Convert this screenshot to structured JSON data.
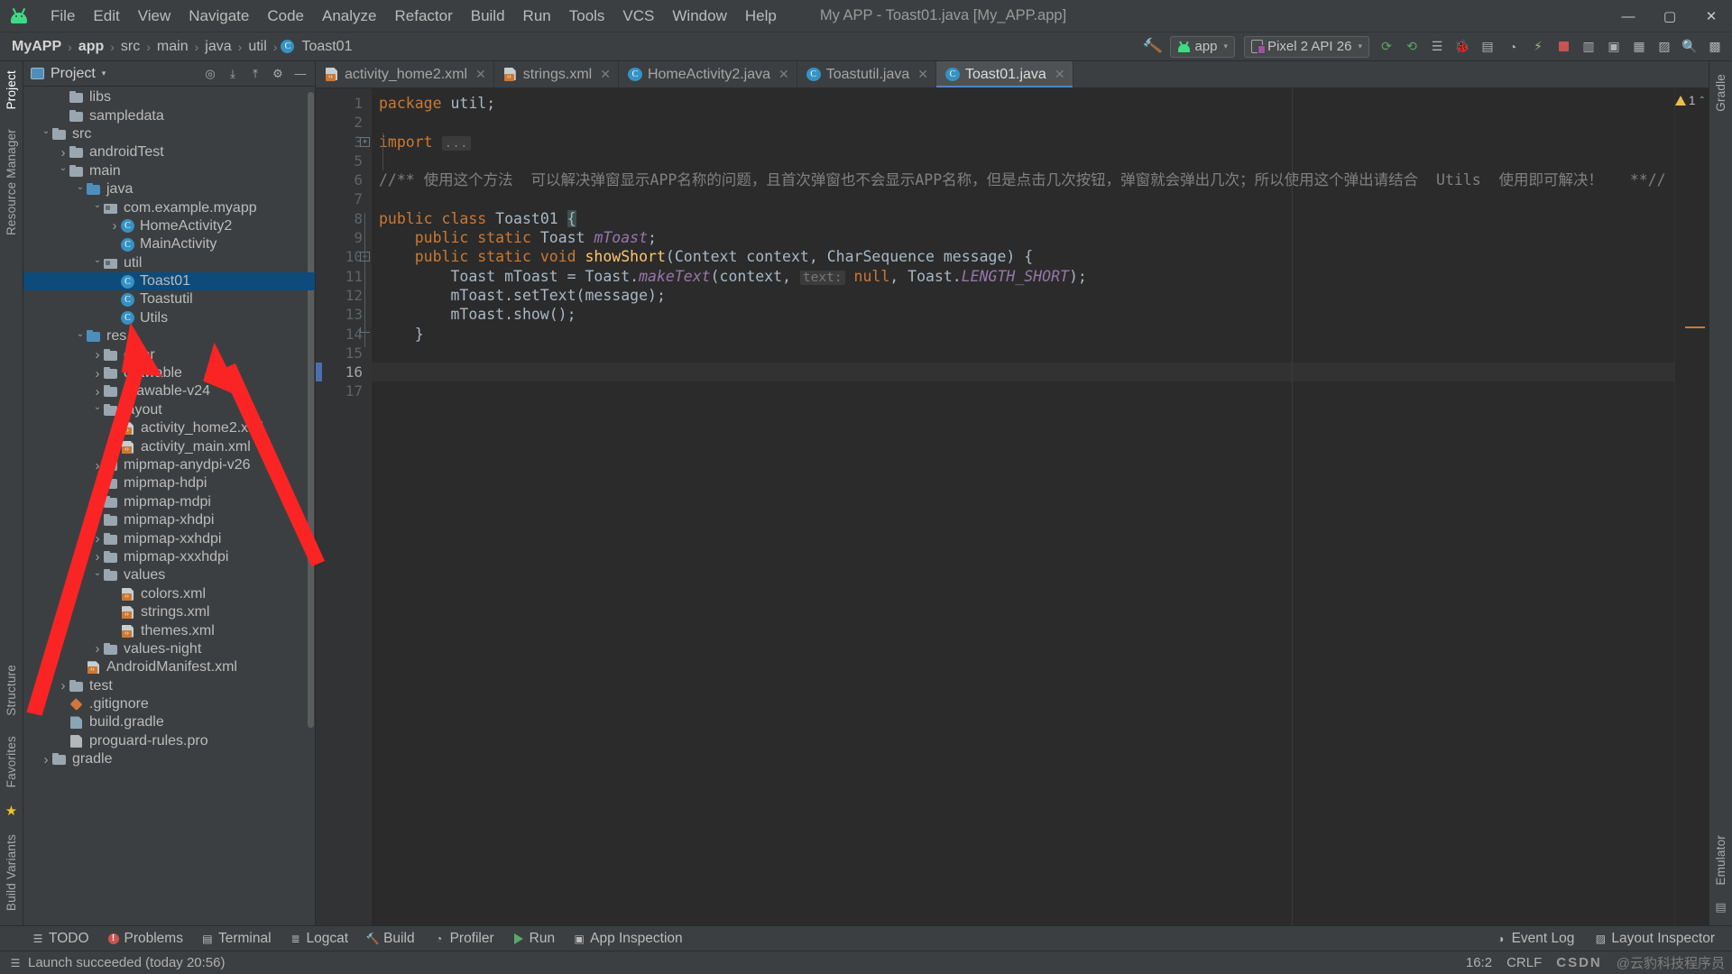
{
  "window": {
    "title": "My APP - Toast01.java [My_APP.app]",
    "minimize": "—",
    "maximize": "▢",
    "close": "✕"
  },
  "menubar": {
    "logo": "android-logo",
    "items": [
      "File",
      "Edit",
      "View",
      "Navigate",
      "Code",
      "Analyze",
      "Refactor",
      "Build",
      "Run",
      "Tools",
      "VCS",
      "Window",
      "Help"
    ]
  },
  "breadcrumb": {
    "items": [
      "MyAPP",
      "app",
      "src",
      "main",
      "java",
      "util",
      "Toast01"
    ],
    "separator": "›",
    "class_badge": "C"
  },
  "toolbar": {
    "build_label": "build-hammer-icon",
    "run_config": "app",
    "device": "Pixel 2 API 26",
    "caret": "▾",
    "icons": [
      "sync-gradle-icon",
      "rerun-icon",
      "avd-manager-icon",
      "debug-icon",
      "attach-debugger-icon",
      "profiler-icon",
      "stop-icon",
      "layout-inspector-icon",
      "sdk-manager-icon",
      "device-file-explorer-icon",
      "search-everywhere-icon",
      "project-structure-icon"
    ]
  },
  "project_panel": {
    "title": "Project",
    "caret": "▾",
    "tools": [
      "locate-icon",
      "expand-all-icon",
      "collapse-all-icon",
      "settings-icon",
      "hide-icon"
    ],
    "tree": [
      {
        "depth": 3,
        "arrow": "none",
        "icon": "folder",
        "label": "libs"
      },
      {
        "depth": 3,
        "arrow": "none",
        "icon": "folder",
        "label": "sampledata"
      },
      {
        "depth": 2,
        "arrow": "down",
        "icon": "folder",
        "label": "src"
      },
      {
        "depth": 3,
        "arrow": "right",
        "icon": "folder",
        "label": "androidTest"
      },
      {
        "depth": 3,
        "arrow": "down",
        "icon": "folder",
        "label": "main"
      },
      {
        "depth": 4,
        "arrow": "down",
        "icon": "folder-src",
        "label": "java"
      },
      {
        "depth": 5,
        "arrow": "down",
        "icon": "package",
        "label": "com.example.myapp"
      },
      {
        "depth": 6,
        "arrow": "right",
        "icon": "class",
        "label": "HomeActivity2"
      },
      {
        "depth": 6,
        "arrow": "none",
        "icon": "class",
        "label": "MainActivity"
      },
      {
        "depth": 5,
        "arrow": "down",
        "icon": "package",
        "label": "util"
      },
      {
        "depth": 6,
        "arrow": "none",
        "icon": "class",
        "label": "Toast01",
        "selected": true
      },
      {
        "depth": 6,
        "arrow": "none",
        "icon": "class",
        "label": "Toastutil"
      },
      {
        "depth": 6,
        "arrow": "none",
        "icon": "class",
        "label": "Utils"
      },
      {
        "depth": 4,
        "arrow": "down",
        "icon": "folder-src",
        "label": "res"
      },
      {
        "depth": 5,
        "arrow": "right",
        "icon": "folder",
        "label": "color"
      },
      {
        "depth": 5,
        "arrow": "right",
        "icon": "folder",
        "label": "drawable"
      },
      {
        "depth": 5,
        "arrow": "right",
        "icon": "folder",
        "label": "drawable-v24"
      },
      {
        "depth": 5,
        "arrow": "down",
        "icon": "folder",
        "label": "layout"
      },
      {
        "depth": 6,
        "arrow": "none",
        "icon": "xml",
        "label": "activity_home2.xml"
      },
      {
        "depth": 6,
        "arrow": "none",
        "icon": "xml",
        "label": "activity_main.xml"
      },
      {
        "depth": 5,
        "arrow": "right",
        "icon": "folder",
        "label": "mipmap-anydpi-v26"
      },
      {
        "depth": 5,
        "arrow": "right",
        "icon": "folder",
        "label": "mipmap-hdpi"
      },
      {
        "depth": 5,
        "arrow": "right",
        "icon": "folder",
        "label": "mipmap-mdpi"
      },
      {
        "depth": 5,
        "arrow": "right",
        "icon": "folder",
        "label": "mipmap-xhdpi"
      },
      {
        "depth": 5,
        "arrow": "right",
        "icon": "folder",
        "label": "mipmap-xxhdpi"
      },
      {
        "depth": 5,
        "arrow": "right",
        "icon": "folder",
        "label": "mipmap-xxxhdpi"
      },
      {
        "depth": 5,
        "arrow": "down",
        "icon": "folder",
        "label": "values"
      },
      {
        "depth": 6,
        "arrow": "none",
        "icon": "xml",
        "label": "colors.xml"
      },
      {
        "depth": 6,
        "arrow": "none",
        "icon": "xml",
        "label": "strings.xml"
      },
      {
        "depth": 6,
        "arrow": "none",
        "icon": "xml",
        "label": "themes.xml"
      },
      {
        "depth": 5,
        "arrow": "right",
        "icon": "folder",
        "label": "values-night"
      },
      {
        "depth": 4,
        "arrow": "none",
        "icon": "xml",
        "label": "AndroidManifest.xml"
      },
      {
        "depth": 3,
        "arrow": "right",
        "icon": "folder",
        "label": "test"
      },
      {
        "depth": 3,
        "arrow": "none",
        "icon": "gitfile",
        "label": ".gitignore"
      },
      {
        "depth": 3,
        "arrow": "none",
        "icon": "gradle",
        "label": "build.gradle"
      },
      {
        "depth": 3,
        "arrow": "none",
        "icon": "prop",
        "label": "proguard-rules.pro"
      },
      {
        "depth": 2,
        "arrow": "right",
        "icon": "folder",
        "label": "gradle"
      }
    ]
  },
  "left_strip": {
    "tabs": [
      "Project",
      "Resource Manager",
      "Structure",
      "Favorites",
      "Build Variants"
    ]
  },
  "right_strip": {
    "tabs": [
      "Gradle",
      "Emulator",
      "Device File Explorer"
    ]
  },
  "editor_tabs": [
    {
      "icon": "xml",
      "label": "activity_home2.xml",
      "active": false,
      "close": "✕"
    },
    {
      "icon": "xml",
      "label": "strings.xml",
      "active": false,
      "close": "✕"
    },
    {
      "icon": "class",
      "label": "HomeActivity2.java",
      "active": false,
      "close": "✕"
    },
    {
      "icon": "class",
      "label": "Toastutil.java",
      "active": false,
      "close": "✕"
    },
    {
      "icon": "class",
      "label": "Toast01.java",
      "active": true,
      "close": "✕"
    }
  ],
  "editor": {
    "line_numbers": [
      "1",
      "2",
      "3",
      "5",
      "6",
      "7",
      "8",
      "9",
      "10",
      "11",
      "12",
      "13",
      "14",
      "15",
      "16",
      "17"
    ],
    "current_line": "16",
    "warning_count": "1",
    "warning_icon": "warning-triangle-icon",
    "lines": [
      {
        "n": "1",
        "tokens": [
          {
            "t": "kw",
            "v": "package"
          },
          {
            "t": "txt",
            "v": " util"
          },
          {
            "t": "txt",
            "v": ";"
          }
        ]
      },
      {
        "n": "2",
        "tokens": []
      },
      {
        "n": "3",
        "tokens": [
          {
            "t": "kw",
            "v": "import"
          },
          {
            "t": "txt",
            "v": " "
          },
          {
            "t": "hint",
            "v": "..."
          }
        ],
        "fold": "plus"
      },
      {
        "n": "5",
        "tokens": []
      },
      {
        "n": "6",
        "tokens": [
          {
            "t": "cmt",
            "v": "//** 使用这个方法  可以解决弹窗显示APP名称的问题，且首次弹窗也不会显示APP名称，但是点击几次按钮，弹窗就会弹出几次；所以使用这个弹出请结合  Utils  使用即可解决！   **//"
          }
        ]
      },
      {
        "n": "7",
        "tokens": []
      },
      {
        "n": "8",
        "tokens": [
          {
            "t": "kw",
            "v": "public class"
          },
          {
            "t": "txt",
            "v": " Toast01 "
          },
          {
            "t": "brace",
            "v": "{"
          }
        ]
      },
      {
        "n": "9",
        "tokens": [
          {
            "t": "txt",
            "v": "    "
          },
          {
            "t": "kw",
            "v": "public static"
          },
          {
            "t": "txt",
            "v": " Toast "
          },
          {
            "t": "fld",
            "v": "mToast"
          },
          {
            "t": "txt",
            "v": ";"
          }
        ]
      },
      {
        "n": "10",
        "tokens": [
          {
            "t": "txt",
            "v": "    "
          },
          {
            "t": "kw",
            "v": "public static void"
          },
          {
            "t": "txt",
            "v": " "
          },
          {
            "t": "fn",
            "v": "showShort"
          },
          {
            "t": "txt",
            "v": "(Context context, CharSequence message) {"
          }
        ],
        "fold": "minus"
      },
      {
        "n": "11",
        "tokens": [
          {
            "t": "txt",
            "v": "        Toast mToast = Toast."
          },
          {
            "t": "cst",
            "v": "makeText"
          },
          {
            "t": "txt",
            "v": "(context, "
          },
          {
            "t": "hint",
            "v": "text:"
          },
          {
            "t": "txt",
            "v": " "
          },
          {
            "t": "kw",
            "v": "null"
          },
          {
            "t": "txt",
            "v": ", Toast."
          },
          {
            "t": "cst",
            "v": "LENGTH_SHORT"
          },
          {
            "t": "txt",
            "v": ");"
          }
        ]
      },
      {
        "n": "12",
        "tokens": [
          {
            "t": "txt",
            "v": "        mToast.setText(message);"
          }
        ]
      },
      {
        "n": "13",
        "tokens": [
          {
            "t": "txt",
            "v": "        mToast.show();"
          }
        ]
      },
      {
        "n": "14",
        "tokens": [
          {
            "t": "txt",
            "v": "    }"
          }
        ],
        "fold": "end"
      },
      {
        "n": "15",
        "tokens": []
      },
      {
        "n": "16",
        "tokens": [
          {
            "t": "brace",
            "v": "}"
          },
          {
            "t": "caret",
            "v": ""
          }
        ],
        "current": true
      },
      {
        "n": "17",
        "tokens": []
      }
    ]
  },
  "bottom_tools": [
    {
      "icon": "todo-icon",
      "label": "TODO"
    },
    {
      "icon": "problems-icon",
      "label": "Problems"
    },
    {
      "icon": "terminal-icon",
      "label": "Terminal"
    },
    {
      "icon": "logcat-icon",
      "label": "Logcat"
    },
    {
      "icon": "build-icon",
      "label": "Build"
    },
    {
      "icon": "profiler-icon",
      "label": "Profiler"
    },
    {
      "icon": "run-icon",
      "label": "Run"
    },
    {
      "icon": "app-inspection-icon",
      "label": "App Inspection"
    }
  ],
  "bottom_right_tools": [
    {
      "icon": "event-log-icon",
      "label": "Event Log"
    },
    {
      "icon": "layout-inspector-icon",
      "label": "Layout Inspector"
    }
  ],
  "statusbar": {
    "message": "Launch succeeded (today 20:56)",
    "caret_position": "16:2",
    "line_separator": "CRLF",
    "watermark_brand": "CSDN",
    "watermark_text": "@云豹科技程序员"
  },
  "colors": {
    "accent_blue": "#4a88c7",
    "android_green": "#3ddc84",
    "selection_blue": "#0d4b7a",
    "keyword_orange": "#cc7832",
    "method_yellow": "#ffc66d",
    "field_purple": "#9876aa",
    "comment_gray": "#808080",
    "arrow_red": "#ff2020",
    "editor_bg": "#2b2b2b",
    "panel_bg": "#3c3f41"
  }
}
